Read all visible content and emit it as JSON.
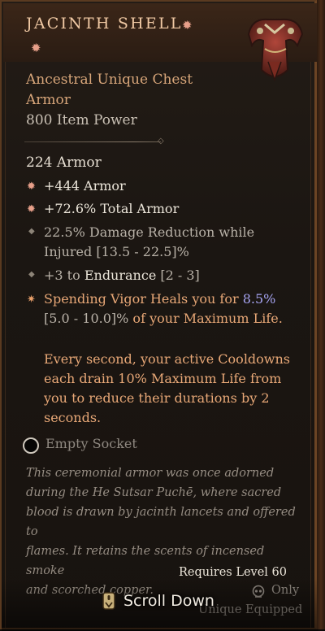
{
  "item": {
    "name": "JACINTH SHELL",
    "type_line1": "Ancestral Unique Chest",
    "type_line2": "Armor",
    "item_power": "800 Item Power",
    "armor_total": "224 Armor"
  },
  "affixes": [
    {
      "text": "+444 Armor",
      "icon": "unique-star-icon"
    },
    {
      "text": "+72.6% Total Armor",
      "icon": "unique-star-icon"
    },
    {
      "text_line1": "22.5% Damage Reduction while",
      "text_line2": "Injured [13.5 - 22.5]%",
      "icon": "diamond-bullet-icon"
    },
    {
      "prefix": "+3 to ",
      "stat": "Endurance",
      "range": " [2 - 3]",
      "icon": "diamond-bullet-icon"
    }
  ],
  "unique_power": {
    "line1_prefix": "Spending Vigor Heals you for ",
    "line1_value": "8.5%",
    "line2_range": "[5.0 - 10.0]%",
    "line2_suffix": " of your Maximum Life.",
    "para2_line1": "Every second, your active Cooldowns",
    "para2_line2": "each drain 10% Maximum Life from",
    "para2_line3": "you to reduce their durations by 2",
    "para2_line4": "seconds.",
    "icon": "legendary-sparkle-icon"
  },
  "socket": {
    "label": "Empty Socket"
  },
  "flavor": [
    "This ceremonial armor was once adorned",
    "during the He Sutsar Puchē, where sacred",
    "blood is drawn by jacinth lancets and offered to",
    "flames. It retains the scents of incensed smoke",
    "and scorched copper."
  ],
  "requirements": {
    "level": "Requires Level 60",
    "only": "Only",
    "unique_equipped": "Unique Equipped"
  },
  "scroll_hint": {
    "label": "Scroll Down",
    "icon": "scroll-icon"
  },
  "colors": {
    "title": "#f0c9a4",
    "type": "#d8a67a",
    "unique_power": "#e8a877",
    "highlight_value": "#a6a4f2",
    "flavor": "#958c82"
  }
}
